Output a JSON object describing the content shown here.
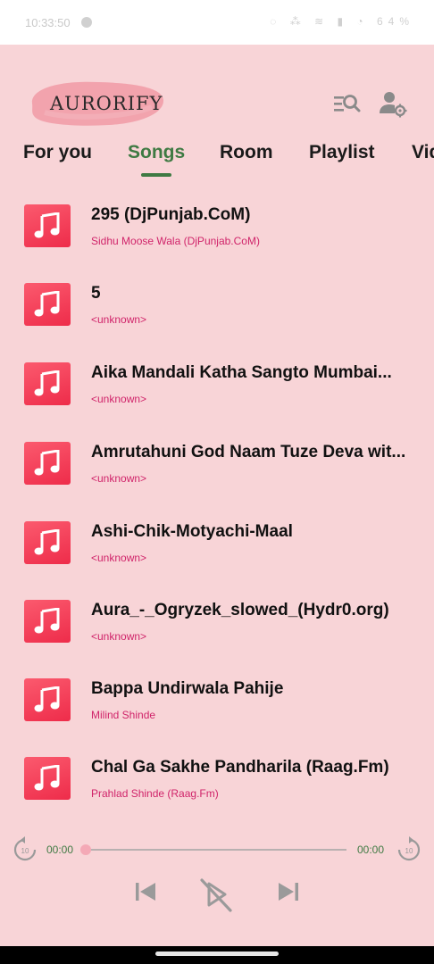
{
  "status_bar": {
    "time": "10:33:50",
    "right_text": "◌ ⁂ ≋ ▮ ◔ 64%"
  },
  "app": {
    "logo_text": "AURORIFY"
  },
  "header_icons": {
    "search": "queue-search-icon",
    "settings": "user-settings-icon"
  },
  "tabs": [
    {
      "label": "For you",
      "active": false
    },
    {
      "label": "Songs",
      "active": true
    },
    {
      "label": "Room",
      "active": false
    },
    {
      "label": "Playlist",
      "active": false
    },
    {
      "label": "Vid",
      "active": false
    }
  ],
  "songs": [
    {
      "title": "295 (DjPunjab.CoM)",
      "artist": "Sidhu Moose Wala (DjPunjab.CoM)"
    },
    {
      "title": "5",
      "artist": "<unknown>"
    },
    {
      "title": "Aika Mandali Katha Sangto  Mumbai...",
      "artist": "<unknown>"
    },
    {
      "title": "Amrutahuni God Naam Tuze Deva wit...",
      "artist": "<unknown>"
    },
    {
      "title": "Ashi-Chik-Motyachi-Maal",
      "artist": "<unknown>"
    },
    {
      "title": "Aura_-_Ogryzek_slowed_(Hydr0.org)",
      "artist": "<unknown>"
    },
    {
      "title": "Bappa Undirwala Pahije",
      "artist": "Milind Shinde"
    },
    {
      "title": "Chal Ga Sakhe Pandharila (Raag.Fm)",
      "artist": "Prahlad Shinde (Raag.Fm)"
    }
  ],
  "player": {
    "current_time": "00:00",
    "total_time": "00:00",
    "progress": 0,
    "rewind_label": "10",
    "forward_label": "10"
  },
  "colors": {
    "background": "#f8d4d7",
    "accent_green": "#3f7a43",
    "artist_pink": "#d0246a",
    "art_red": "#f03a55"
  }
}
